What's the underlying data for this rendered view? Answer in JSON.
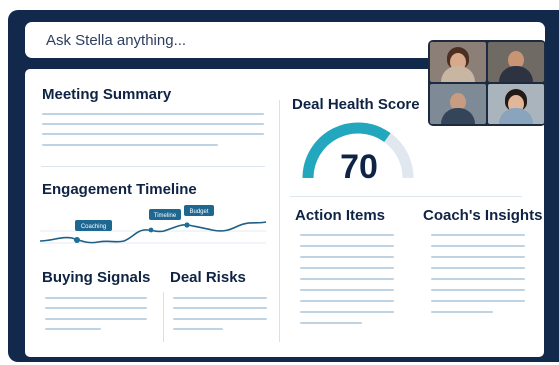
{
  "search": {
    "placeholder": "Ask Stella anything..."
  },
  "meeting_summary": {
    "title": "Meeting Summary"
  },
  "engagement_timeline": {
    "title": "Engagement Timeline",
    "markers": [
      "Coaching",
      "Timeline",
      "Budget"
    ]
  },
  "buying_signals": {
    "title": "Buying Signals"
  },
  "deal_risks": {
    "title": "Deal Risks"
  },
  "deal_health": {
    "title": "Deal Health Score",
    "score": "70",
    "score_value": 70,
    "score_max": 100
  },
  "action_items": {
    "title": "Action Items"
  },
  "coach_insights": {
    "title": "Coach's Insights"
  },
  "video_call": {
    "participants": [
      {
        "icon": "participant-woman-icon"
      },
      {
        "icon": "participant-man-icon"
      },
      {
        "icon": "participant-man-icon"
      },
      {
        "icon": "participant-woman-icon"
      }
    ]
  },
  "colors": {
    "frame": "#13294b",
    "accent": "#22a7bf",
    "heading": "#0f2444",
    "placeholder_line": "#bfd3e3",
    "gauge_track": "#e1e7ee"
  }
}
